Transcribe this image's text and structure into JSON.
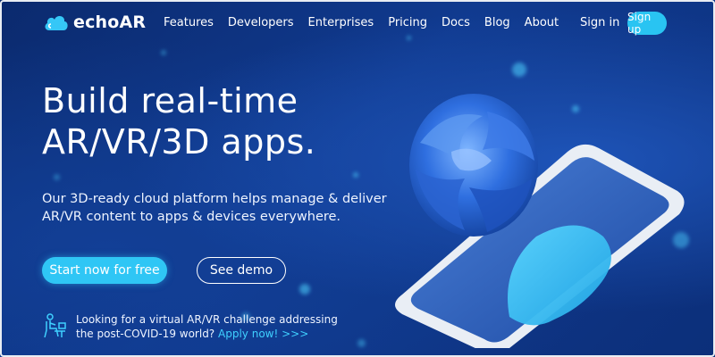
{
  "brand": {
    "name": "echoAR"
  },
  "nav": {
    "links": [
      "Features",
      "Developers",
      "Enterprises",
      "Pricing",
      "Docs",
      "Blog",
      "About"
    ],
    "sign_in": "Sign in",
    "sign_up": "Sign up"
  },
  "hero": {
    "headline_line1": "Build real-time",
    "headline_line2": "AR/VR/3D apps.",
    "subtitle_line1": "Our 3D-ready cloud platform helps manage & deliver",
    "subtitle_line2": "AR/VR content to apps & devices everywhere.",
    "primary_button": "Start now for free",
    "secondary_button": "See demo"
  },
  "promo": {
    "line1": "Looking for a virtual AR/VR challenge addressing",
    "line2_prefix": "the post-COVID-19 world?",
    "link_text": "Apply now! >>>"
  },
  "colors": {
    "accent": "#2fc6f5",
    "link": "#3fd0ff",
    "background": "#103a8f"
  },
  "icons": [
    "cloud-logo-icon",
    "person-at-desk-icon"
  ]
}
